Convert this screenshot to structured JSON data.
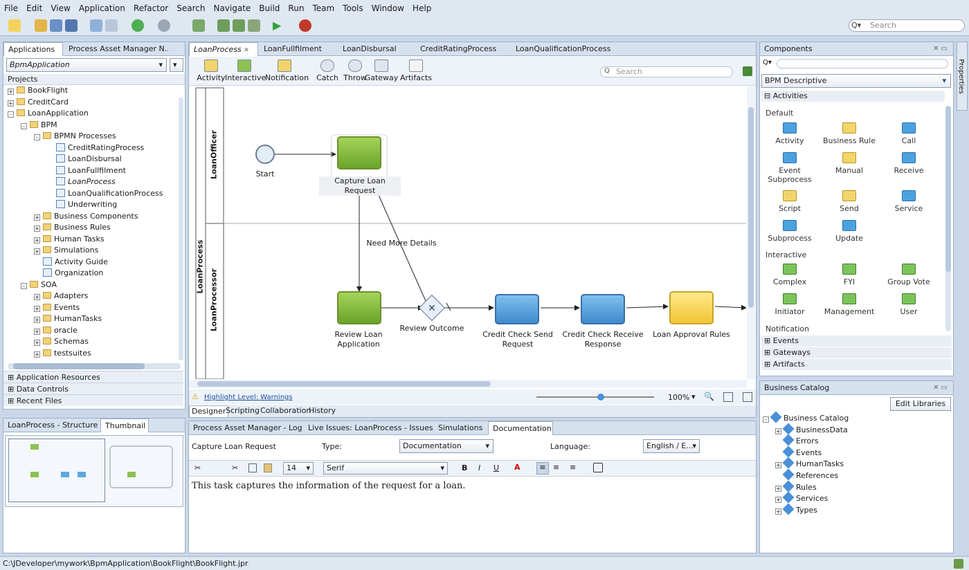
{
  "menu": [
    "File",
    "Edit",
    "View",
    "Application",
    "Refactor",
    "Search",
    "Navigate",
    "Build",
    "Run",
    "Team",
    "Tools",
    "Window",
    "Help"
  ],
  "global_search": {
    "placeholder": "Search"
  },
  "left_panel": {
    "tabs": [
      "Applications",
      "Process Asset Manager N..."
    ],
    "app_selector": "BpmApplication",
    "projects_label": "Projects",
    "tree": [
      {
        "label": "BookFlight",
        "level": 0,
        "kind": "folder",
        "exp": "+"
      },
      {
        "label": "CreditCard",
        "level": 0,
        "kind": "folder",
        "exp": "+"
      },
      {
        "label": "LoanApplication",
        "level": 0,
        "kind": "folder",
        "exp": "-"
      },
      {
        "label": "BPM",
        "level": 1,
        "kind": "folder",
        "exp": "-"
      },
      {
        "label": "BPMN Processes",
        "level": 2,
        "kind": "folder",
        "exp": "-"
      },
      {
        "label": "CreditRatingProcess",
        "level": 3,
        "kind": "doc"
      },
      {
        "label": "LoanDisbursal",
        "level": 3,
        "kind": "doc"
      },
      {
        "label": "LoanFullfilment",
        "level": 3,
        "kind": "doc"
      },
      {
        "label": "LoanProcess",
        "level": 3,
        "kind": "doc",
        "italic": true
      },
      {
        "label": "LoanQualificationProcess",
        "level": 3,
        "kind": "doc"
      },
      {
        "label": "Underwriting",
        "level": 3,
        "kind": "doc"
      },
      {
        "label": "Business Components",
        "level": 2,
        "kind": "folder",
        "exp": "+"
      },
      {
        "label": "Business Rules",
        "level": 2,
        "kind": "folder",
        "exp": "+"
      },
      {
        "label": "Human Tasks",
        "level": 2,
        "kind": "folder",
        "exp": "+"
      },
      {
        "label": "Simulations",
        "level": 2,
        "kind": "folder",
        "exp": "+"
      },
      {
        "label": "Activity Guide",
        "level": 2,
        "kind": "doc"
      },
      {
        "label": "Organization",
        "level": 2,
        "kind": "doc"
      },
      {
        "label": "SOA",
        "level": 1,
        "kind": "folder",
        "exp": "-"
      },
      {
        "label": "Adapters",
        "level": 2,
        "kind": "folder",
        "exp": "+"
      },
      {
        "label": "Events",
        "level": 2,
        "kind": "folder",
        "exp": "+"
      },
      {
        "label": "HumanTasks",
        "level": 2,
        "kind": "folder",
        "exp": "+"
      },
      {
        "label": "oracle",
        "level": 2,
        "kind": "folder",
        "exp": "+"
      },
      {
        "label": "Schemas",
        "level": 2,
        "kind": "folder",
        "exp": "+"
      },
      {
        "label": "testsuites",
        "level": 2,
        "kind": "folder",
        "exp": "+"
      }
    ],
    "sections": [
      "Application Resources",
      "Data Controls",
      "Recent Files"
    ]
  },
  "structure_panel": {
    "tabs": [
      "LoanProcess - Structure",
      "Thumbnail"
    ]
  },
  "editor": {
    "tabs": [
      "LoanProcess",
      "LoanFullfilment",
      "LoanDisbursal",
      "CreditRatingProcess",
      "LoanQualificationProcess"
    ],
    "palette": [
      "Activity",
      "Interactive",
      "Notification",
      "Catch",
      "Throw",
      "Gateway",
      "Artifacts"
    ],
    "search_placeholder": "Search",
    "pool": "LoanProcess",
    "lanes": [
      "LoanOfficer",
      "LoanProcessor"
    ],
    "nodes": {
      "start": "Start",
      "capture": "Capture Loan Request",
      "review_app": "Review Loan Application",
      "review_outcome": "Review Outcome",
      "send": "Credit Check Send Request",
      "receive": "Credit Check Receive Response",
      "rules": "Loan Approval Rules",
      "edge_label": "Need More Details"
    },
    "highlight": "Highlight Level: Warnings",
    "zoom": "100%",
    "bottom_tabs": [
      "Designer",
      "Scripting",
      "Collaboration",
      "History"
    ]
  },
  "log_panel": {
    "tabs": [
      "Process Asset Manager - Log",
      "Live Issues: LoanProcess - Issues",
      "Simulations",
      "Documentation"
    ],
    "task": "Capture Loan Request",
    "type_label": "Type:",
    "type_value": "Documentation",
    "language_label": "Language:",
    "language_value": "English / E...",
    "font_size": "14",
    "font_name": "Serif",
    "text": "This task captures the information of the request for a loan."
  },
  "components": {
    "title": "Components",
    "category": "BPM Descriptive",
    "activities_label": "Activities",
    "default_label": "Default",
    "default_items": [
      "Activity",
      "Business Rule",
      "Call",
      "Event Subprocess",
      "Manual",
      "Receive",
      "Script",
      "Send",
      "Service",
      "Subprocess",
      "Update"
    ],
    "interactive_label": "Interactive",
    "interactive_items": [
      "Complex",
      "FYI",
      "Group Vote",
      "Initiator",
      "Management",
      "User"
    ],
    "notification_label": "Notification",
    "sections": [
      "Events",
      "Gateways",
      "Artifacts"
    ]
  },
  "catalog": {
    "title": "Business Catalog",
    "edit_button": "Edit Libraries",
    "root": "Business Catalog",
    "items": [
      "BusinessData",
      "Errors",
      "Events",
      "HumanTasks",
      "References",
      "Rules",
      "Services",
      "Types"
    ]
  },
  "properties_tab": "Properties",
  "status_path": "C:\\JDeveloper\\mywork\\BpmApplication\\BookFlight\\BookFlight.jpr"
}
